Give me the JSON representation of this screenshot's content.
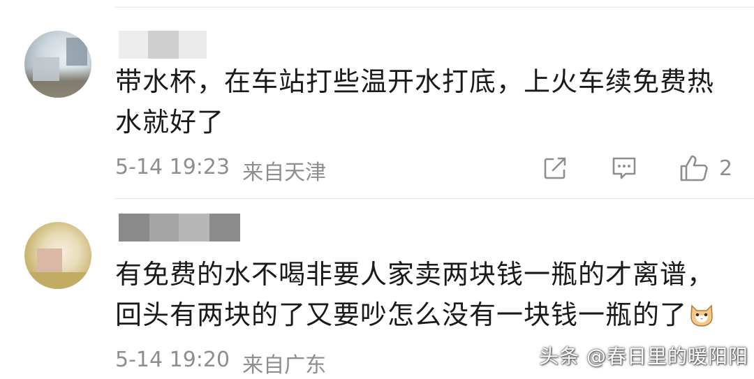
{
  "comments": [
    {
      "text": "带水杯，在车站打些温开水打底，上火车续免费热水就好了",
      "time": "5-14 19:23",
      "location": "来自天津",
      "like_count": "2"
    },
    {
      "text": "有免费的水不喝非要人家卖两块钱一瓶的才离谱，回头有两块的了又要吵怎么没有一块钱一瓶的了",
      "time": "5-14 19:20",
      "location": "来自广东"
    }
  ],
  "watermark": "头条 @春日里的暖阳阳",
  "icons": {
    "share": "share-icon",
    "comment": "comment-icon",
    "like": "thumbs-up-icon",
    "emoji": "cat-emoji-icon"
  },
  "colors": {
    "text": "#1a1a1a",
    "meta": "#8e8e8e",
    "divider": "#e6e6e6"
  }
}
